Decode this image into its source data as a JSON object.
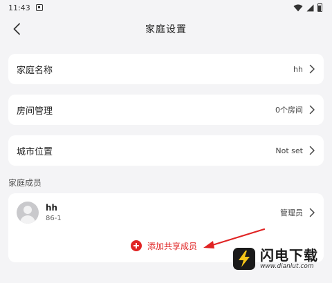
{
  "statusbar": {
    "time": "11:43",
    "icons": [
      "notification-icon",
      "wifi-icon",
      "signal-icon",
      "battery-icon"
    ]
  },
  "navbar": {
    "title": "家庭设置",
    "back_icon": "chevron-left-icon"
  },
  "settings": [
    {
      "label": "家庭名称",
      "value": "hh"
    },
    {
      "label": "房间管理",
      "value": "0个房间"
    },
    {
      "label": "城市位置",
      "value": "Not set"
    }
  ],
  "members_section": {
    "title": "家庭成员",
    "members": [
      {
        "name": "hh",
        "id": "86-1",
        "role": "管理员"
      }
    ],
    "add_label": "添加共享成员"
  },
  "watermark": {
    "brand": "闪电下载",
    "url": "www.dianlut.com"
  },
  "colors": {
    "accent": "#e02424",
    "background": "#f4f4f6",
    "card": "#ffffff"
  }
}
